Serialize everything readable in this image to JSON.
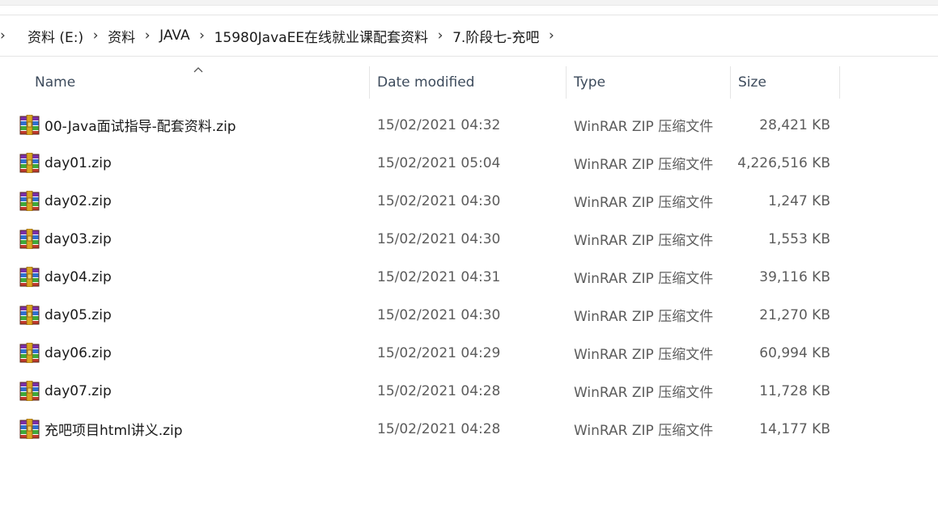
{
  "breadcrumb": {
    "items": [
      {
        "label": "资料 (E:)"
      },
      {
        "label": "资料"
      },
      {
        "label": "JAVA"
      },
      {
        "label": "15980JavaEE在线就业课配套资料"
      },
      {
        "label": "7.阶段七-充吧"
      }
    ]
  },
  "columns": {
    "name": "Name",
    "date": "Date modified",
    "type": "Type",
    "size": "Size"
  },
  "files": [
    {
      "name": "00-Java面试指导-配套资料.zip",
      "date": "15/02/2021 04:32",
      "type": "WinRAR ZIP 压缩文件",
      "size": "28,421 KB",
      "icon": "winrar-zip-icon"
    },
    {
      "name": "day01.zip",
      "date": "15/02/2021 05:04",
      "type": "WinRAR ZIP 压缩文件",
      "size": "4,226,516 KB",
      "icon": "winrar-zip-icon"
    },
    {
      "name": "day02.zip",
      "date": "15/02/2021 04:30",
      "type": "WinRAR ZIP 压缩文件",
      "size": "1,247 KB",
      "icon": "winrar-zip-icon"
    },
    {
      "name": "day03.zip",
      "date": "15/02/2021 04:30",
      "type": "WinRAR ZIP 压缩文件",
      "size": "1,553 KB",
      "icon": "winrar-zip-icon"
    },
    {
      "name": "day04.zip",
      "date": "15/02/2021 04:31",
      "type": "WinRAR ZIP 压缩文件",
      "size": "39,116 KB",
      "icon": "winrar-zip-icon"
    },
    {
      "name": "day05.zip",
      "date": "15/02/2021 04:30",
      "type": "WinRAR ZIP 压缩文件",
      "size": "21,270 KB",
      "icon": "winrar-zip-icon"
    },
    {
      "name": "day06.zip",
      "date": "15/02/2021 04:29",
      "type": "WinRAR ZIP 压缩文件",
      "size": "60,994 KB",
      "icon": "winrar-zip-icon"
    },
    {
      "name": "day07.zip",
      "date": "15/02/2021 04:28",
      "type": "WinRAR ZIP 压缩文件",
      "size": "11,728 KB",
      "icon": "winrar-zip-icon"
    },
    {
      "name": "充吧项目html讲义.zip",
      "date": "15/02/2021 04:28",
      "type": "WinRAR ZIP 压缩文件",
      "size": "14,177 KB",
      "icon": "winrar-zip-icon"
    }
  ]
}
